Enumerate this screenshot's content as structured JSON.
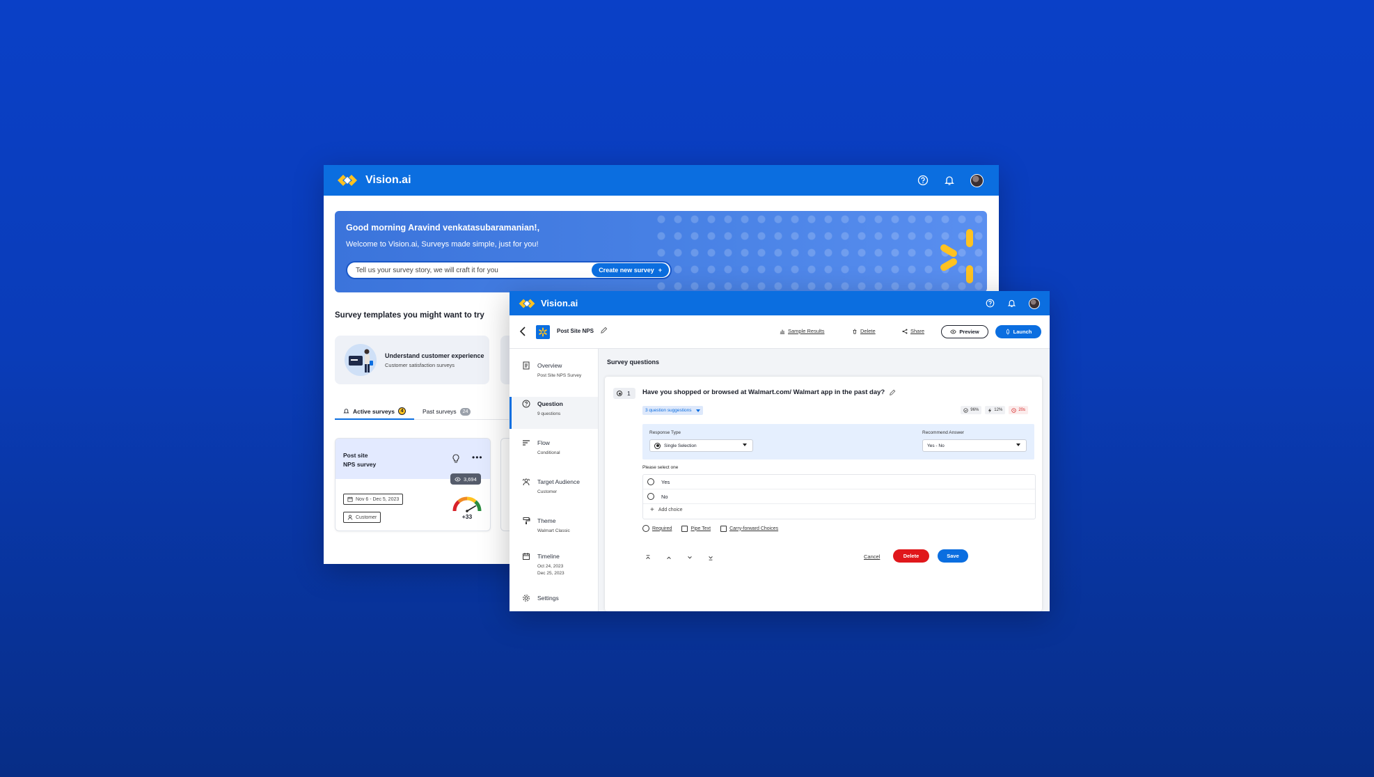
{
  "colors": {
    "brand_blue": "#0b6ee0",
    "spark_yellow": "#ffc220",
    "danger_red": "#e0171b"
  },
  "app_name": "Vision.ai",
  "dashboard": {
    "greeting": "Good morning Aravind venkatasubaramanian!,",
    "welcome": "Welcome to Vision.ai, Surveys made simple, just for you!",
    "search_placeholder": "Tell us your survey story, we will craft it for you",
    "create_button": "Create new survey",
    "templates_title": "Survey templates you might want to try",
    "template": {
      "title": "Understand customer experience",
      "subtitle": "Customer satisfaction surveys"
    },
    "tabs": [
      {
        "label": "Active surveys",
        "count": "4"
      },
      {
        "label": "Past surveys",
        "count": "24"
      }
    ],
    "survey_card": {
      "title_line1": "Post site",
      "title_line2": "NPS survey",
      "views": "3,694",
      "date_range": "Nov 6 - Dec 5, 2023",
      "audience": "Customer",
      "score": "+33",
      "score_level": 0.83
    }
  },
  "editor": {
    "survey_name": "Post Site NPS",
    "actions": {
      "sample_results": "Sample Results",
      "delete": "Delete",
      "share": "Share",
      "preview": "Preview",
      "launch": "Launch"
    },
    "nav": [
      {
        "label": "Overview",
        "sub": "Post Site NPS Survey"
      },
      {
        "label": "Question",
        "sub": "9 questions"
      },
      {
        "label": "Flow",
        "sub": "Conditional"
      },
      {
        "label": "Target Audience",
        "sub": "Customer"
      },
      {
        "label": "Theme",
        "sub": "Walmart Classic"
      },
      {
        "label": "Timeline",
        "sub": "Oct 24, 2023",
        "sub2": "Dec 25, 2023"
      },
      {
        "label": "Settings",
        "sub": ""
      }
    ],
    "section_title": "Survey questions",
    "question": {
      "number": "1",
      "text": "Have you shopped or browsed at Walmart.com/ Walmart app in the past day?",
      "suggestions": "3 question suggestions",
      "metrics": [
        "96%",
        "12%",
        "20s"
      ],
      "response_type_label": "Response Type",
      "response_type_value": "Single Selection",
      "recommend_label": "Recommend Answer",
      "recommend_value": "Yes - No",
      "please_select": "Please select one",
      "choices": [
        "Yes",
        "No"
      ],
      "add_choice": "Add choice",
      "options": [
        "Required",
        "Pipe Text",
        "Carry-forward Choices"
      ],
      "cancel": "Cancel",
      "delete": "Delete",
      "save": "Save"
    }
  }
}
